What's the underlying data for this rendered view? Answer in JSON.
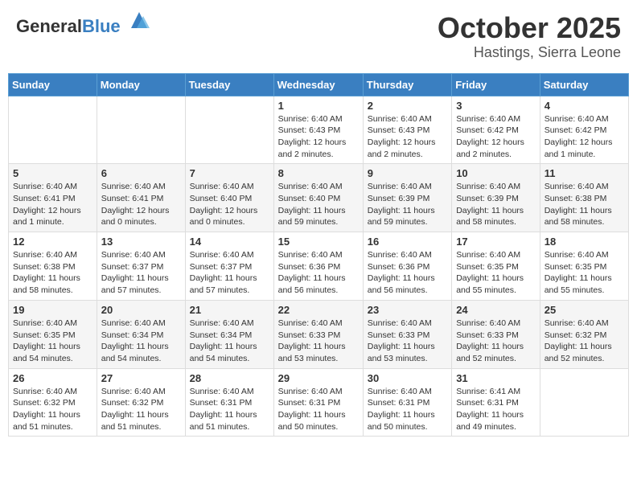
{
  "header": {
    "logo_general": "General",
    "logo_blue": "Blue",
    "month": "October 2025",
    "location": "Hastings, Sierra Leone"
  },
  "weekdays": [
    "Sunday",
    "Monday",
    "Tuesday",
    "Wednesday",
    "Thursday",
    "Friday",
    "Saturday"
  ],
  "weeks": [
    [
      {
        "day": "",
        "content": ""
      },
      {
        "day": "",
        "content": ""
      },
      {
        "day": "",
        "content": ""
      },
      {
        "day": "1",
        "content": "Sunrise: 6:40 AM\nSunset: 6:43 PM\nDaylight: 12 hours and 2 minutes."
      },
      {
        "day": "2",
        "content": "Sunrise: 6:40 AM\nSunset: 6:43 PM\nDaylight: 12 hours and 2 minutes."
      },
      {
        "day": "3",
        "content": "Sunrise: 6:40 AM\nSunset: 6:42 PM\nDaylight: 12 hours and 2 minutes."
      },
      {
        "day": "4",
        "content": "Sunrise: 6:40 AM\nSunset: 6:42 PM\nDaylight: 12 hours and 1 minute."
      }
    ],
    [
      {
        "day": "5",
        "content": "Sunrise: 6:40 AM\nSunset: 6:41 PM\nDaylight: 12 hours and 1 minute."
      },
      {
        "day": "6",
        "content": "Sunrise: 6:40 AM\nSunset: 6:41 PM\nDaylight: 12 hours and 0 minutes."
      },
      {
        "day": "7",
        "content": "Sunrise: 6:40 AM\nSunset: 6:40 PM\nDaylight: 12 hours and 0 minutes."
      },
      {
        "day": "8",
        "content": "Sunrise: 6:40 AM\nSunset: 6:40 PM\nDaylight: 11 hours and 59 minutes."
      },
      {
        "day": "9",
        "content": "Sunrise: 6:40 AM\nSunset: 6:39 PM\nDaylight: 11 hours and 59 minutes."
      },
      {
        "day": "10",
        "content": "Sunrise: 6:40 AM\nSunset: 6:39 PM\nDaylight: 11 hours and 58 minutes."
      },
      {
        "day": "11",
        "content": "Sunrise: 6:40 AM\nSunset: 6:38 PM\nDaylight: 11 hours and 58 minutes."
      }
    ],
    [
      {
        "day": "12",
        "content": "Sunrise: 6:40 AM\nSunset: 6:38 PM\nDaylight: 11 hours and 58 minutes."
      },
      {
        "day": "13",
        "content": "Sunrise: 6:40 AM\nSunset: 6:37 PM\nDaylight: 11 hours and 57 minutes."
      },
      {
        "day": "14",
        "content": "Sunrise: 6:40 AM\nSunset: 6:37 PM\nDaylight: 11 hours and 57 minutes."
      },
      {
        "day": "15",
        "content": "Sunrise: 6:40 AM\nSunset: 6:36 PM\nDaylight: 11 hours and 56 minutes."
      },
      {
        "day": "16",
        "content": "Sunrise: 6:40 AM\nSunset: 6:36 PM\nDaylight: 11 hours and 56 minutes."
      },
      {
        "day": "17",
        "content": "Sunrise: 6:40 AM\nSunset: 6:35 PM\nDaylight: 11 hours and 55 minutes."
      },
      {
        "day": "18",
        "content": "Sunrise: 6:40 AM\nSunset: 6:35 PM\nDaylight: 11 hours and 55 minutes."
      }
    ],
    [
      {
        "day": "19",
        "content": "Sunrise: 6:40 AM\nSunset: 6:35 PM\nDaylight: 11 hours and 54 minutes."
      },
      {
        "day": "20",
        "content": "Sunrise: 6:40 AM\nSunset: 6:34 PM\nDaylight: 11 hours and 54 minutes."
      },
      {
        "day": "21",
        "content": "Sunrise: 6:40 AM\nSunset: 6:34 PM\nDaylight: 11 hours and 54 minutes."
      },
      {
        "day": "22",
        "content": "Sunrise: 6:40 AM\nSunset: 6:33 PM\nDaylight: 11 hours and 53 minutes."
      },
      {
        "day": "23",
        "content": "Sunrise: 6:40 AM\nSunset: 6:33 PM\nDaylight: 11 hours and 53 minutes."
      },
      {
        "day": "24",
        "content": "Sunrise: 6:40 AM\nSunset: 6:33 PM\nDaylight: 11 hours and 52 minutes."
      },
      {
        "day": "25",
        "content": "Sunrise: 6:40 AM\nSunset: 6:32 PM\nDaylight: 11 hours and 52 minutes."
      }
    ],
    [
      {
        "day": "26",
        "content": "Sunrise: 6:40 AM\nSunset: 6:32 PM\nDaylight: 11 hours and 51 minutes."
      },
      {
        "day": "27",
        "content": "Sunrise: 6:40 AM\nSunset: 6:32 PM\nDaylight: 11 hours and 51 minutes."
      },
      {
        "day": "28",
        "content": "Sunrise: 6:40 AM\nSunset: 6:31 PM\nDaylight: 11 hours and 51 minutes."
      },
      {
        "day": "29",
        "content": "Sunrise: 6:40 AM\nSunset: 6:31 PM\nDaylight: 11 hours and 50 minutes."
      },
      {
        "day": "30",
        "content": "Sunrise: 6:40 AM\nSunset: 6:31 PM\nDaylight: 11 hours and 50 minutes."
      },
      {
        "day": "31",
        "content": "Sunrise: 6:41 AM\nSunset: 6:31 PM\nDaylight: 11 hours and 49 minutes."
      },
      {
        "day": "",
        "content": ""
      }
    ]
  ]
}
